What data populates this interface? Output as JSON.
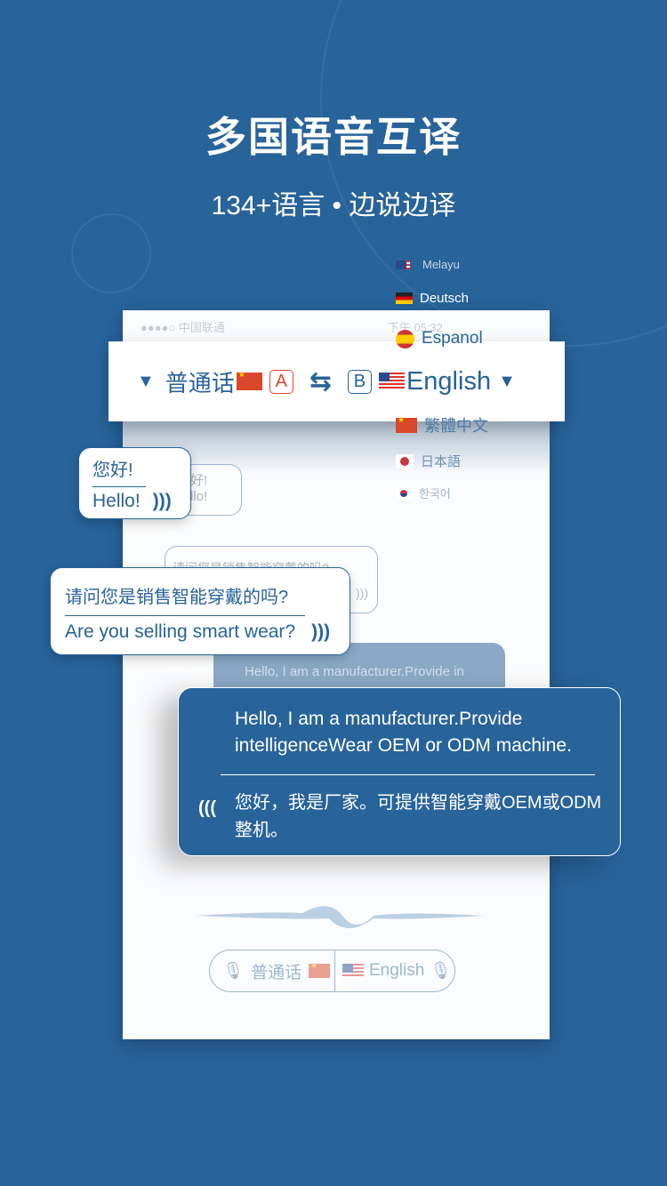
{
  "header": {
    "title": "多国语音互译",
    "subtitle": "134+语言 • 边说边译"
  },
  "status_bar": {
    "carrier": "●●●●○ 中国联通",
    "time": "下午 05:32"
  },
  "language_bar": {
    "source_language": "普通话",
    "source_badge": "A",
    "target_badge": "B",
    "target_language": "English"
  },
  "language_list": [
    {
      "label": "Melayu",
      "flag": "malaysia"
    },
    {
      "label": "Deutsch",
      "flag": "germany"
    },
    {
      "label": "Espanol",
      "flag": "spain"
    },
    {
      "label": "繁體中文",
      "flag": "china"
    },
    {
      "label": "日本語",
      "flag": "japan"
    },
    {
      "label": "한국어",
      "flag": "korea"
    }
  ],
  "conversation": [
    {
      "original": "您好!",
      "translation": "Hello!"
    },
    {
      "original": "请问您是销售智能穿戴的吗?",
      "translation": "Are you selling smart wear?"
    },
    {
      "original": "Hello, I am a manufacturer.Provide intelligenceWear OEM or ODM machine.",
      "translation": "您好，我是厂家。可提供智能穿戴OEM或ODM整机。",
      "preview": "Hello, I am a manufacturer.Provide in"
    }
  ],
  "ghost": {
    "greeting": "好!",
    "hello": "llo!",
    "question": "请问您是销售智能穿戴的吗?"
  },
  "bottom_bar": {
    "left_button": "普通话",
    "right_button": "English"
  },
  "colors": {
    "background": "#28639a",
    "accent": "#28639a",
    "badge_a": "#d9472b"
  }
}
